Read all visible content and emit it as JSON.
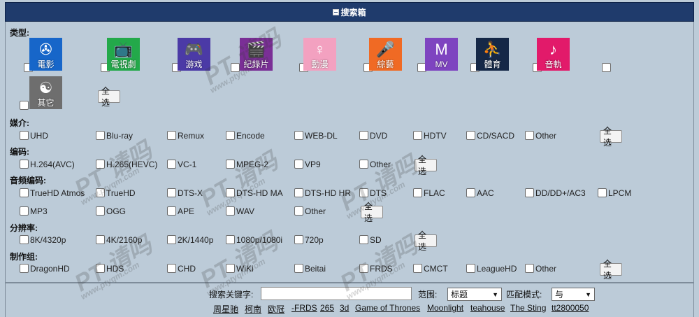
{
  "header": {
    "title": "搜索箱"
  },
  "categories": {
    "label": "类型:",
    "items": [
      {
        "label": "電影",
        "icon": "film-reel-icon",
        "glyph": "✇",
        "bg": "#1766c9"
      },
      {
        "label": "電視劇",
        "icon": "tv-icon",
        "glyph": "📺",
        "bg": "#23a94a"
      },
      {
        "label": "游戏",
        "icon": "gamepad-icon",
        "glyph": "🎮",
        "bg": "#4b3aa6"
      },
      {
        "label": "紀錄片",
        "icon": "documentary-icon",
        "glyph": "🎬",
        "bg": "#7a2f96"
      },
      {
        "label": "動漫",
        "icon": "anime-icon",
        "glyph": "♀",
        "bg": "#f3a1c0"
      },
      {
        "label": "綜藝",
        "icon": "microphone-icon",
        "glyph": "🎤",
        "bg": "#f06a24"
      },
      {
        "label": "MV",
        "icon": "mtv-icon",
        "glyph": "M",
        "bg": "#7e44c0"
      },
      {
        "label": "體育",
        "icon": "basketball-player-icon",
        "glyph": "⛹",
        "bg": "#152847"
      },
      {
        "label": "音軌",
        "icon": "music-note-icon",
        "glyph": "♪",
        "bg": "#e21a6a"
      },
      {
        "label": "",
        "icon": "",
        "glyph": "",
        "bg": ""
      },
      {
        "label": "其它",
        "icon": "yin-yang-icon",
        "glyph": "☯",
        "bg": "#6e6e6e"
      }
    ],
    "select_all": "全选"
  },
  "media": {
    "label": "媒介:",
    "options": [
      "UHD",
      "Blu-ray",
      "Remux",
      "Encode",
      "WEB-DL",
      "DVD",
      "HDTV",
      "CD/SACD",
      "Other"
    ],
    "select_all": "全选"
  },
  "codec": {
    "label": "编码:",
    "options": [
      "H.264(AVC)",
      "H.265(HEVC)",
      "VC-1",
      "MPEG-2",
      "VP9",
      "Other"
    ],
    "select_all": "全选"
  },
  "audio": {
    "label": "音频编码:",
    "options": [
      "TrueHD Atmos",
      "TrueHD",
      "DTS-X",
      "DTS-HD MA",
      "DTS-HD HR",
      "DTS",
      "FLAC",
      "AAC",
      "DD/DD+/AC3",
      "LPCM",
      "MP3",
      "OGG",
      "APE",
      "WAV",
      "Other"
    ],
    "select_all": "全选"
  },
  "resolution": {
    "label": "分辨率:",
    "options": [
      "8K/4320p",
      "4K/2160p",
      "2K/1440p",
      "1080p/1080i",
      "720p",
      "SD"
    ],
    "select_all": "全选"
  },
  "team": {
    "label": "制作组:",
    "options": [
      "DragonHD",
      "HDS",
      "CHD",
      "WiKi",
      "Beitai",
      "FRDS",
      "CMCT",
      "LeagueHD",
      "Other"
    ],
    "select_all": "全选"
  },
  "search": {
    "keyword_label": "搜索关键字:",
    "keyword_value": "",
    "scope_label": "范围:",
    "scope_value": "标题",
    "match_label": "匹配模式:",
    "match_value": "与",
    "hot_terms": [
      "周星驰",
      "柯南",
      "欧冠",
      "-FRDS",
      "265",
      "3d",
      "Game of Thrones",
      "Moonlight",
      "teahouse",
      "The Sting",
      "tt2800050"
    ]
  },
  "watermark": {
    "text": "PT 请吗",
    "url": "www.ptyqm.com"
  }
}
